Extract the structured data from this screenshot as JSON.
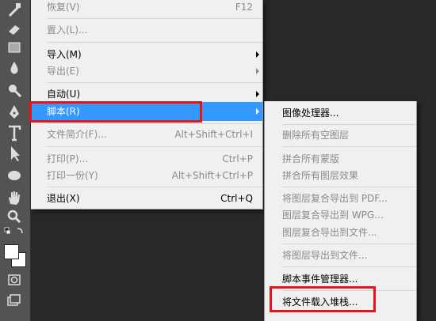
{
  "menu": {
    "items": [
      {
        "label": "恢复(V)",
        "shortcut": "F12"
      },
      {
        "label": "置入(L)..."
      },
      {
        "label": "导入(M)"
      },
      {
        "label": "导出(E)"
      },
      {
        "label": "自动(U)"
      },
      {
        "label": "脚本(R)"
      },
      {
        "label": "文件简介(F)...",
        "shortcut": "Alt+Shift+Ctrl+I"
      },
      {
        "label": "打印(P)...",
        "shortcut": "Ctrl+P"
      },
      {
        "label": "打印一份(Y)",
        "shortcut": "Alt+Shift+Ctrl+P"
      },
      {
        "label": "退出(X)",
        "shortcut": "Ctrl+Q"
      }
    ]
  },
  "submenu": {
    "items": [
      {
        "label": "图像处理器..."
      },
      {
        "label": "删除所有空图层"
      },
      {
        "label": "拼合所有蒙版"
      },
      {
        "label": "拼合所有图层效果"
      },
      {
        "label": "将图层复合导出到 PDF..."
      },
      {
        "label": "图层复合导出到 WPG..."
      },
      {
        "label": "图层复合导出到文件..."
      },
      {
        "label": "将图层导出到文件..."
      },
      {
        "label": "脚本事件管理器..."
      },
      {
        "label": "将文件载入堆栈..."
      }
    ]
  },
  "colors": {
    "highlight": "#3399ff",
    "annotation": "#e8141a",
    "disabled_text": "#8a8a8a"
  }
}
